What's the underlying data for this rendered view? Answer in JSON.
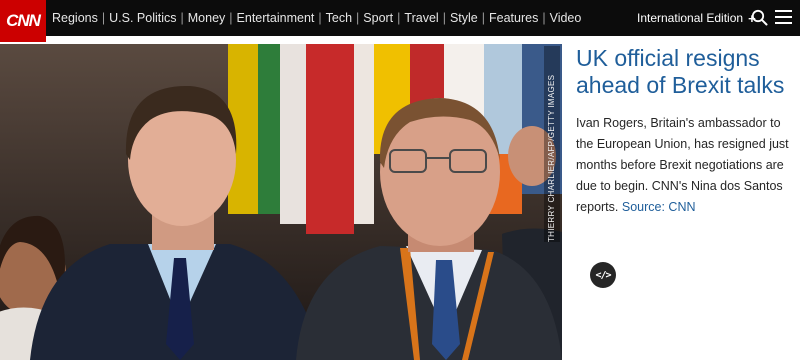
{
  "brand": {
    "logo_text": "CNN",
    "color": "#cc0000"
  },
  "nav": {
    "links": [
      "Regions",
      "U.S. Politics",
      "Money",
      "Entertainment",
      "Tech",
      "Sport",
      "Travel",
      "Style",
      "Features",
      "Video"
    ],
    "separator": "|",
    "edition_label": "International Edition",
    "edition_toggle": "+",
    "icons": [
      "search-icon",
      "menu-icon"
    ]
  },
  "photo": {
    "credit": "THIERRY CHARLIER/AFP/GETTY IMAGES"
  },
  "article": {
    "headline": "UK official resigns ahead of Brexit talks",
    "description": "Ivan Rogers, Britain's ambassador to the European Union, has resigned just months before Brexit negotiations are due to begin. CNN's Nina dos Santos reports.",
    "source_label": "Source: CNN",
    "embed_icon_text": "</>"
  },
  "colors": {
    "nav_bg": "#0c0c0c",
    "link_blue": "#1f5e9a"
  }
}
